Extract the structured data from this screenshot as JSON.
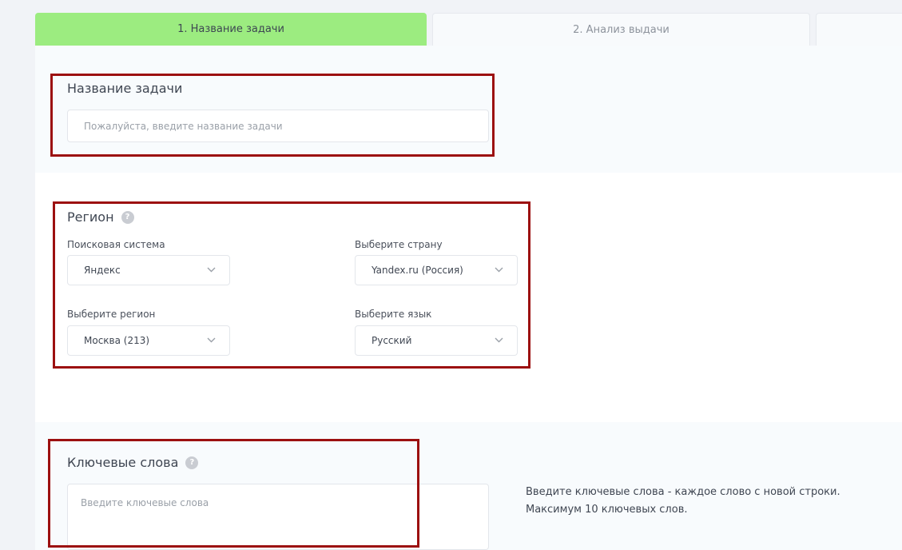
{
  "tabs": [
    {
      "label": "1. Название задачи"
    },
    {
      "label": "2. Анализ выдачи"
    },
    {
      "label": ""
    }
  ],
  "task_name": {
    "title": "Название задачи",
    "placeholder": "Пожалуйста, введите название задачи"
  },
  "region": {
    "title": "Регион",
    "help_glyph": "?",
    "search_engine": {
      "label": "Поисковая система",
      "value": "Яндекс"
    },
    "country": {
      "label": "Выберите страну",
      "value": "Yandex.ru (Россия)"
    },
    "city": {
      "label": "Выберите регион",
      "value": "Москва (213)"
    },
    "language": {
      "label": "Выберите язык",
      "value": "Русский"
    }
  },
  "keywords": {
    "title": "Ключевые слова",
    "help_glyph": "?",
    "placeholder": "Введите ключевые слова",
    "hint_line1": "Введите ключевые слова - каждое слово с новой строки.",
    "hint_line2": "Максимум 10 ключевых слов."
  },
  "colors": {
    "active_tab": "#9cec80",
    "highlight_frame": "#9c1010"
  }
}
